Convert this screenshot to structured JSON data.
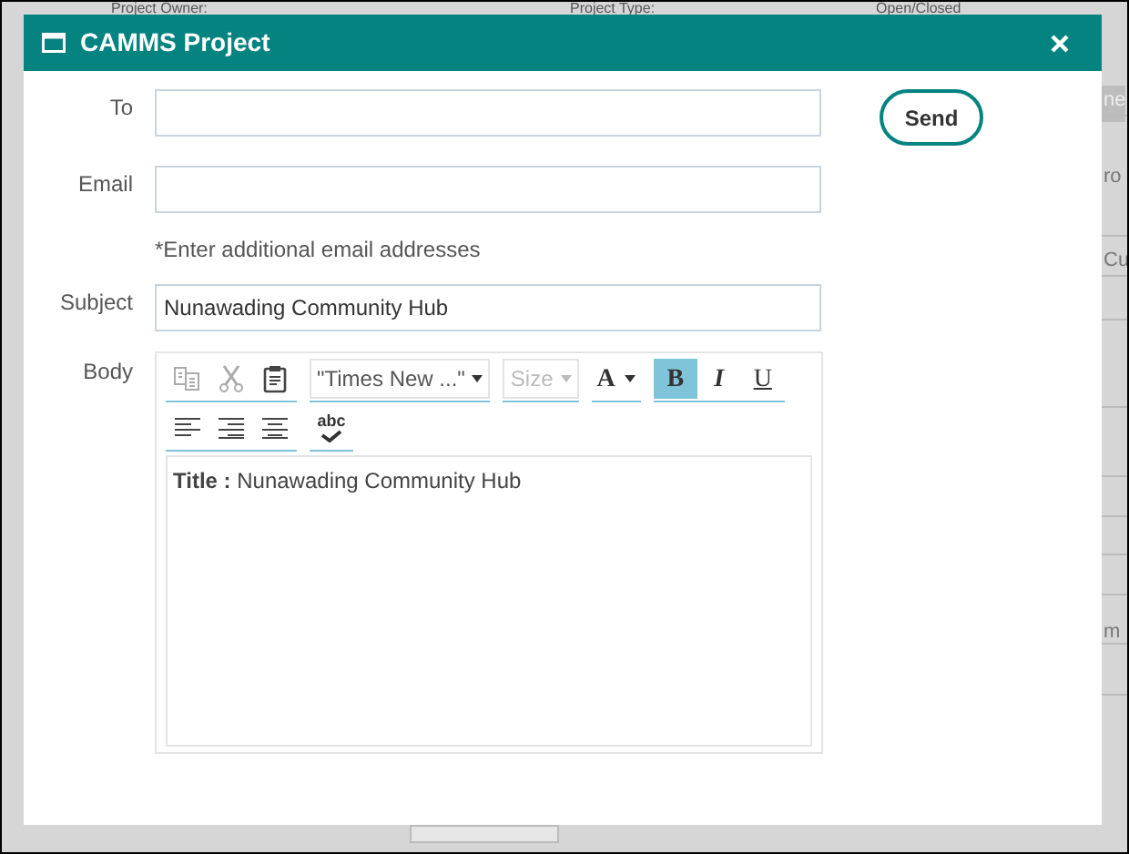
{
  "background": {
    "header_labels": [
      "Project Owner:",
      "Project Type:",
      "Open/Closed"
    ],
    "edge_texts": [
      {
        "text": "ne",
        "kind": "header"
      },
      {
        "text": "ro",
        "kind": "plain"
      },
      {
        "text": "Cu",
        "kind": "plain"
      },
      {
        "text": "m",
        "kind": "plain"
      }
    ]
  },
  "dialog": {
    "title": "CAMMS Project"
  },
  "fields": [
    {
      "label": "To"
    },
    {
      "label": "Email",
      "hint": "*Enter additional email addresses"
    },
    {
      "label": "Subject",
      "value": "Nunawading Community Hub"
    }
  ],
  "send_button": "Send",
  "body": {
    "label": "Body",
    "toolbar_rows": [
      [
        {
          "group": [
            {
              "kind": "copy"
            },
            {
              "kind": "cut"
            },
            {
              "kind": "paste"
            }
          ]
        },
        {
          "group": [
            {
              "kind": "font",
              "text": "\"Times New ...\"",
              "disabled": false
            }
          ]
        },
        {
          "group": [
            {
              "kind": "size",
              "text": "Size",
              "disabled": true
            }
          ]
        },
        {
          "group": [
            {
              "kind": "color",
              "text": "A"
            }
          ]
        },
        {
          "group": [
            {
              "kind": "bold",
              "text": "B",
              "selected": true
            },
            {
              "kind": "italic",
              "text": "I",
              "selected": false
            },
            {
              "kind": "underline",
              "text": "U",
              "selected": false
            }
          ]
        }
      ],
      [
        {
          "group": [
            {
              "kind": "align-left"
            },
            {
              "kind": "align-right"
            },
            {
              "kind": "align-center"
            }
          ]
        },
        {
          "group": [
            {
              "kind": "spellcheck",
              "text": "abc"
            }
          ]
        }
      ]
    ],
    "content": "**Title :** Nunawading Community Hub"
  }
}
